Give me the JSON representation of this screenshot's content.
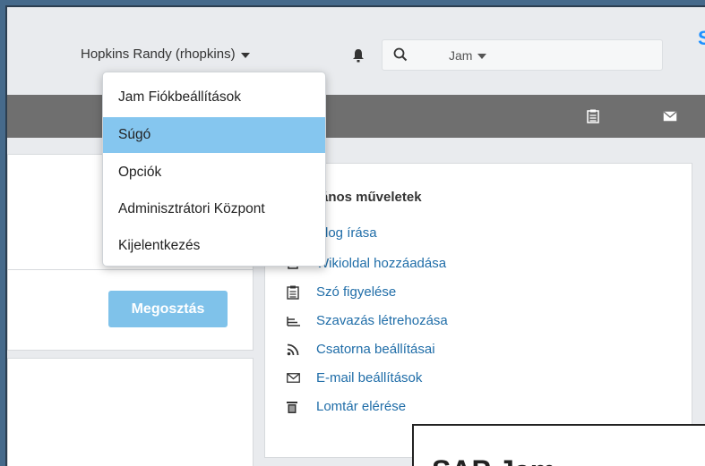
{
  "header": {
    "user_label": "Hopkins Randy (rhopkins)",
    "search_scope": "Jam",
    "brand_peek": "S"
  },
  "user_dropdown": {
    "items": [
      {
        "label": "Jam Fiókbeállítások",
        "active": false
      },
      {
        "label": "Súgó",
        "active": true
      },
      {
        "label": "Opciók",
        "active": false
      },
      {
        "label": "Adminisztrátori Központ",
        "active": false
      },
      {
        "label": "Kijelentkezés",
        "active": false
      }
    ]
  },
  "main": {
    "share_button": "Megosztás"
  },
  "general_actions": {
    "title": "ános műveletek",
    "items": [
      {
        "label": "Blog írása",
        "icon": "pencil-icon"
      },
      {
        "label": "Wikioldal hozzáadása",
        "icon": "wiki-icon"
      },
      {
        "label": "Szó figyelése",
        "icon": "clipboard-icon"
      },
      {
        "label": "Szavazás létrehozása",
        "icon": "poll-icon"
      },
      {
        "label": "Csatorna beállításai",
        "icon": "rss-icon"
      },
      {
        "label": "E-mail beállítások",
        "icon": "envelope-icon"
      },
      {
        "label": "Lomtár elérése",
        "icon": "trash-icon"
      }
    ]
  },
  "popup": {
    "title": "SAP Jam"
  },
  "colors": {
    "accent": "#85c6ef",
    "link": "#1f6da8",
    "navbar": "#6f6f6f",
    "outer": "#466a8b"
  }
}
